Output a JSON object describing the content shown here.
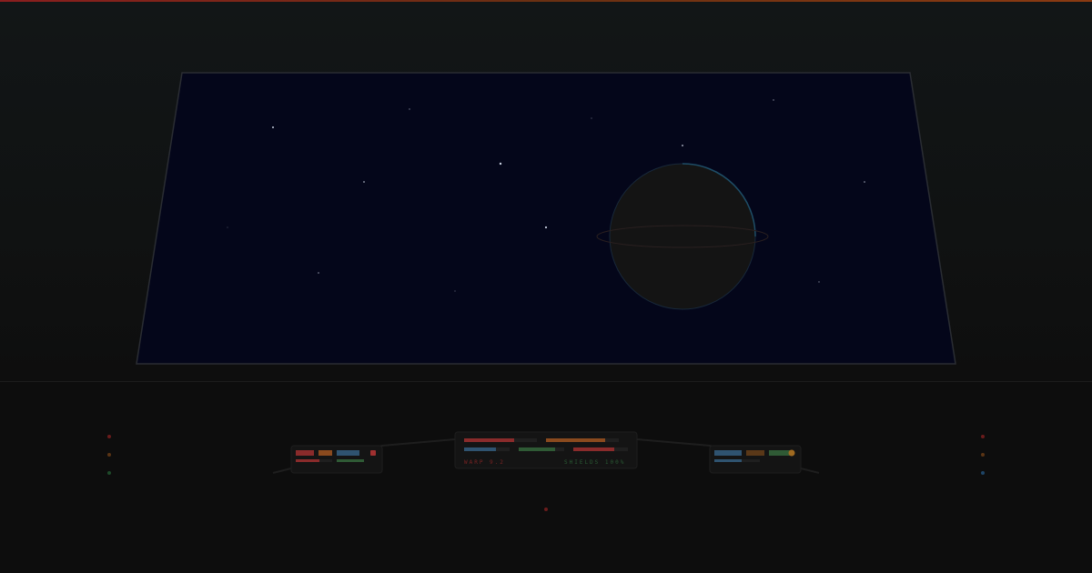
{
  "colors": {
    "red": "#8a2b2b",
    "orange": "#8a4a1e",
    "blue": "#2f5370",
    "green": "#2f5a35",
    "space": "#04061a",
    "planet": "#141414",
    "planet_rim": "#1e4d66"
  },
  "console": {
    "warp_readout": "WARP 9.2",
    "shields_readout": "SHIELDS 100%",
    "warp_color": "#7a2323",
    "shields_color": "#2a5a34"
  },
  "gauges": {
    "center": [
      {
        "name": "hull",
        "color": "#8a2b2b",
        "fill": 0.6875
      },
      {
        "name": "power",
        "color": "#8a4a1e",
        "fill": 0.8125
      },
      {
        "name": "sensors",
        "color": "#2f5370",
        "fill": 0.7
      },
      {
        "name": "shields",
        "color": "#2f5a35",
        "fill": 0.8
      },
      {
        "name": "weapons",
        "color": "#8a2b2b",
        "fill": 0.75
      }
    ],
    "left": [
      {
        "name": "aux-red",
        "color": "#8a2b2b",
        "fill": 0.65
      },
      {
        "name": "aux-green",
        "color": "#2f5a35",
        "fill": 1.0
      }
    ],
    "right": [
      {
        "name": "aux-blue",
        "color": "#2f5370",
        "fill": 0.6
      }
    ]
  },
  "icons": {
    "left_panel_light": "alert-light-icon",
    "right_panel_light": "status-light-icon"
  }
}
